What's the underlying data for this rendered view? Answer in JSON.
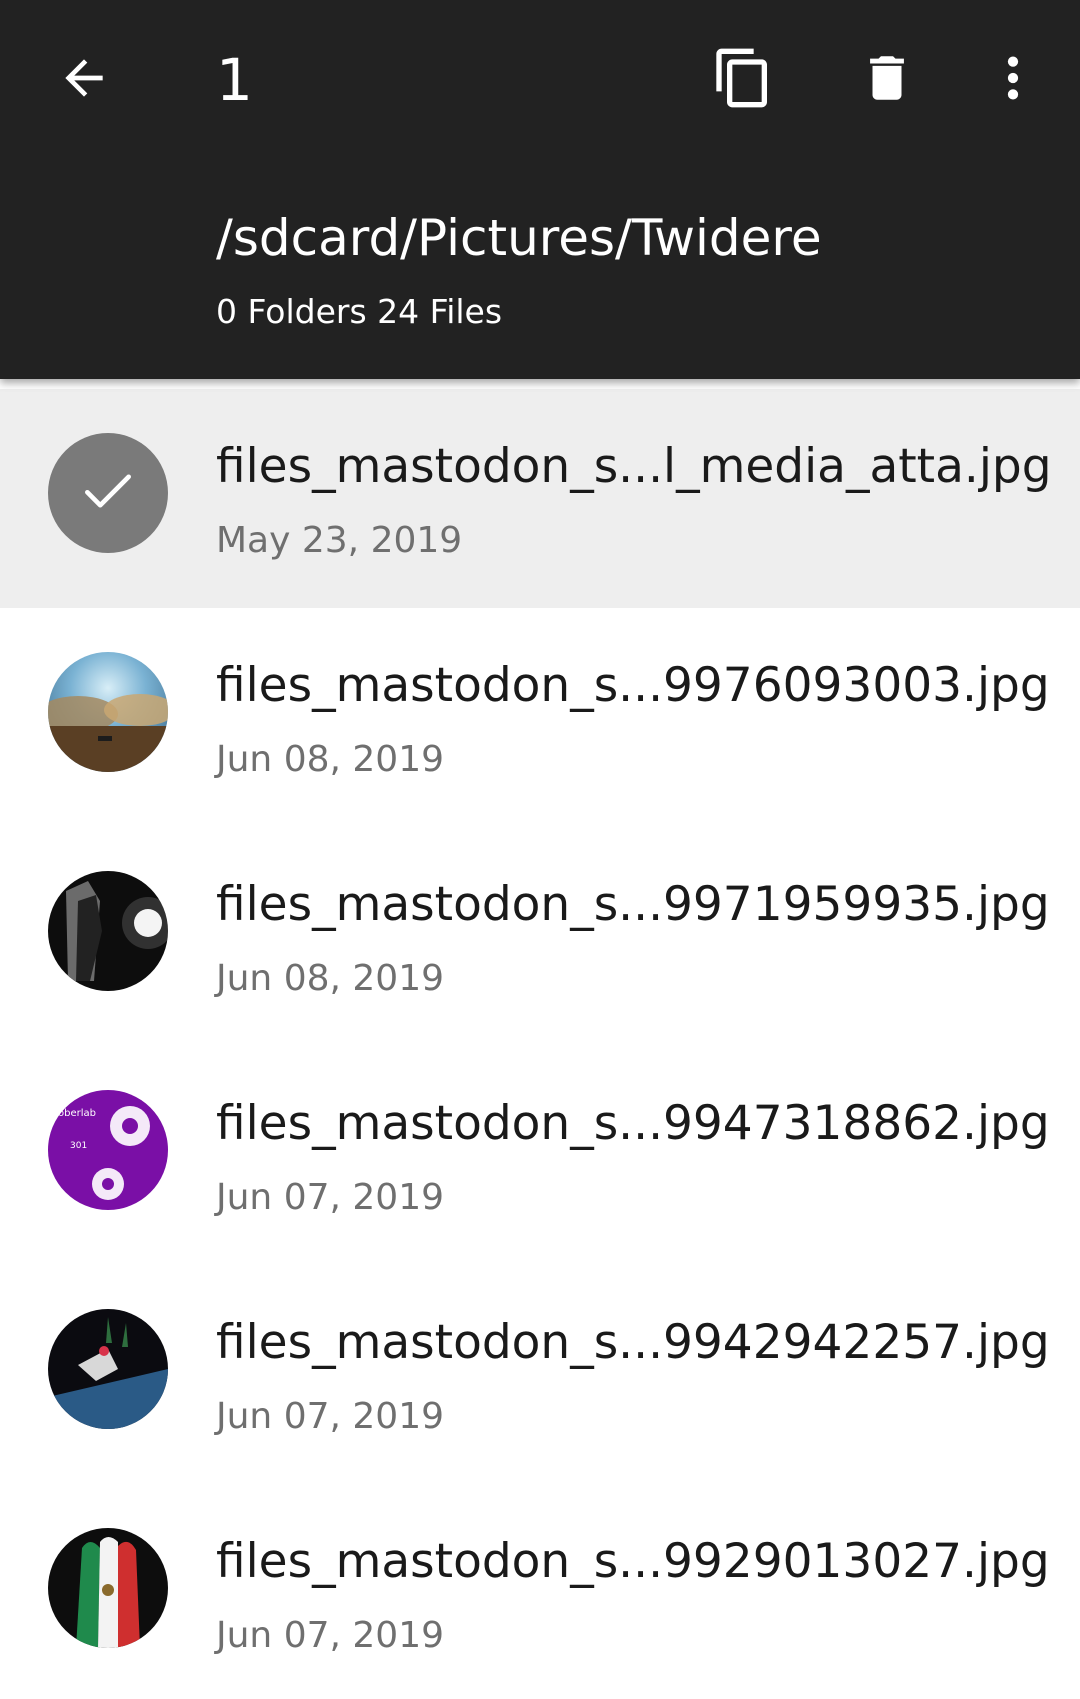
{
  "toolbar": {
    "selected_count": "1",
    "icons": {
      "back": "arrow-back-icon",
      "copy": "copy-icon",
      "delete": "delete-icon",
      "more": "more-vertical-icon"
    }
  },
  "folder": {
    "path": "/sdcard/Pictures/Twidere",
    "summary": "0 Folders 24 Files"
  },
  "files": [
    {
      "name": "files_mastodon_s...l_media_atta.jpg",
      "date": "May 23, 2019",
      "selected": true
    },
    {
      "name": "files_mastodon_s...9976093003.jpg",
      "date": "Jun 08, 2019",
      "selected": false
    },
    {
      "name": "files_mastodon_s...9971959935.jpg",
      "date": "Jun 08, 2019",
      "selected": false
    },
    {
      "name": "files_mastodon_s...9947318862.jpg",
      "date": "Jun 07, 2019",
      "selected": false
    },
    {
      "name": "files_mastodon_s...9942942257.jpg",
      "date": "Jun 07, 2019",
      "selected": false
    },
    {
      "name": "files_mastodon_s...9929013027.jpg",
      "date": "Jun 07, 2019",
      "selected": false
    }
  ],
  "colors": {
    "appbar": "#222222",
    "selected_row": "#eeeeee",
    "check_circle": "#7a7a7a"
  }
}
